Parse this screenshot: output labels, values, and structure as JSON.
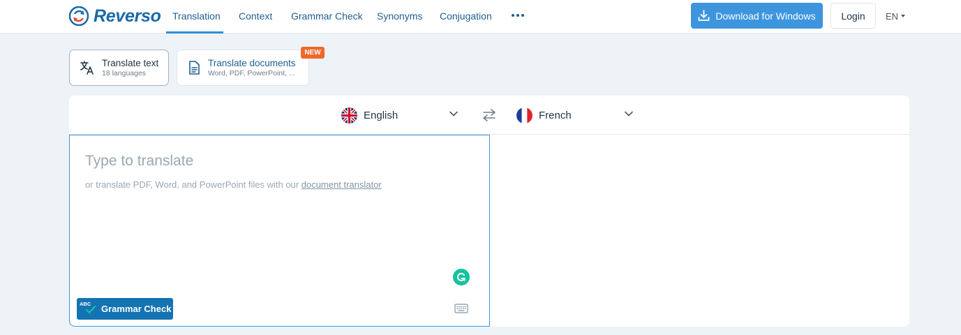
{
  "header": {
    "logo_text": "Reverso",
    "nav": [
      {
        "label": "Translation",
        "active": true
      },
      {
        "label": "Context"
      },
      {
        "label": "Grammar Check"
      },
      {
        "label": "Synonyms"
      },
      {
        "label": "Conjugation"
      }
    ],
    "more_icon": "ellipsis-icon",
    "download_label": "Download for Windows",
    "login_label": "Login",
    "ui_language": "EN"
  },
  "modes": {
    "text": {
      "title": "Translate text",
      "subtitle": "18 languages",
      "icon": "translate-icon"
    },
    "documents": {
      "title": "Translate documents",
      "subtitle": "Word, PDF, PowerPoint, ...",
      "badge": "NEW",
      "icon": "document-icon"
    }
  },
  "translator": {
    "source_language": "English",
    "target_language": "French",
    "source_flag": "uk-flag-icon",
    "target_flag": "france-flag-icon",
    "placeholder": "Type to translate",
    "hint_prefix": "or translate PDF, Word, and PowerPoint files with our ",
    "hint_link": "document translator",
    "grammar_check_label": "Grammar Check",
    "grammar_badge": "ABC"
  },
  "colors": {
    "brand": "#1a6aa8",
    "accent": "#3d95de",
    "new_badge": "#f0692b",
    "grammarly": "#15c39a",
    "grammar_button": "#1473b3"
  }
}
